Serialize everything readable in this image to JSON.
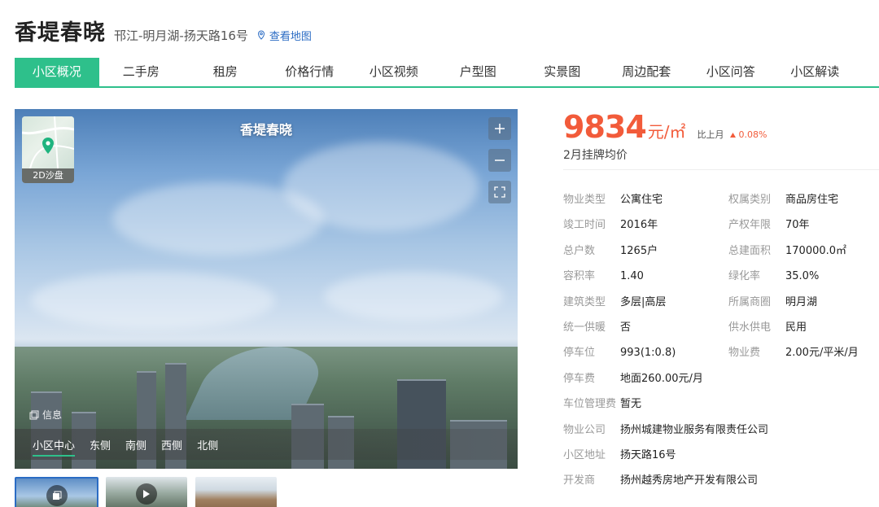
{
  "header": {
    "title": "香堤春晓",
    "address": "邗江-明月湖-扬天路16号",
    "map_link": "查看地图"
  },
  "tabs": [
    {
      "label": "小区概况",
      "active": true
    },
    {
      "label": "二手房"
    },
    {
      "label": "租房"
    },
    {
      "label": "价格行情"
    },
    {
      "label": "小区视频"
    },
    {
      "label": "户型图"
    },
    {
      "label": "实景图"
    },
    {
      "label": "周边配套"
    },
    {
      "label": "小区问答"
    },
    {
      "label": "小区解读"
    }
  ],
  "panorama": {
    "title": "香堤春晓",
    "minimap_label": "2D沙盘",
    "info_label": "信息",
    "views": [
      "小区中心",
      "东侧",
      "南侧",
      "西侧",
      "北侧"
    ],
    "active_view": "小区中心"
  },
  "price": {
    "value": "9834",
    "unit": "元/㎡",
    "mom_label": "比上月",
    "mom_value": "0.08%",
    "sub": "2月挂牌均价"
  },
  "attributes_left": [
    {
      "k": "物业类型",
      "v": "公寓住宅"
    },
    {
      "k": "竣工时间",
      "v": "2016年"
    },
    {
      "k": "总户数",
      "v": "1265户"
    },
    {
      "k": "容积率",
      "v": "1.40"
    },
    {
      "k": "建筑类型",
      "v": "多层|高层"
    },
    {
      "k": "统一供暖",
      "v": "否"
    },
    {
      "k": "停车位",
      "v": "993(1:0.8)"
    },
    {
      "k": "停车费",
      "v": "地面260.00元/月"
    },
    {
      "k": "车位管理费",
      "v": "暂无"
    },
    {
      "k": "物业公司",
      "v": "扬州城建物业服务有限责任公司"
    },
    {
      "k": "小区地址",
      "v": "扬天路16号"
    },
    {
      "k": "开发商",
      "v": "扬州越秀房地产开发有限公司"
    }
  ],
  "attributes_right": [
    {
      "k": "权属类别",
      "v": "商品房住宅"
    },
    {
      "k": "产权年限",
      "v": "70年"
    },
    {
      "k": "总建面积",
      "v": "170000.0㎡"
    },
    {
      "k": "绿化率",
      "v": "35.0%"
    },
    {
      "k": "所属商圈",
      "v": "明月湖"
    },
    {
      "k": "供水供电",
      "v": "民用"
    },
    {
      "k": "物业费",
      "v": "2.00元/平米/月"
    }
  ],
  "colors": {
    "accent": "#2ec08b",
    "price": "#f25b3a",
    "link": "#2b6cc4"
  }
}
